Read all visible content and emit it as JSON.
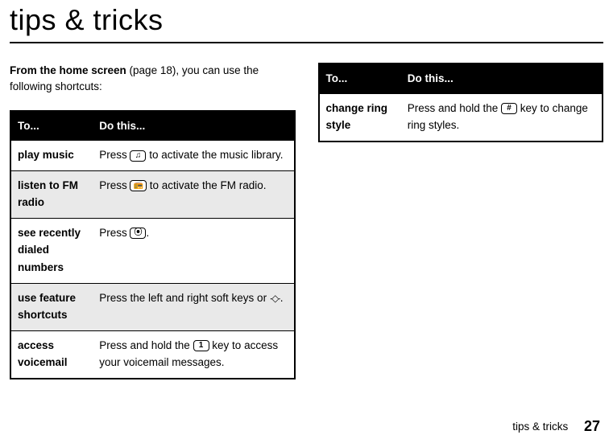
{
  "title": "tips & tricks",
  "intro": {
    "bold": "From the home screen",
    "rest": " (page 18), you can use the following shortcuts:"
  },
  "table1": {
    "headers": {
      "c1": "To...",
      "c2": "Do this..."
    },
    "rows": [
      {
        "label": "play music",
        "pre": "Press ",
        "key": "♫",
        "post": " to activate the music library."
      },
      {
        "label": "listen to FM radio",
        "pre": "Press ",
        "key": "📻",
        "post": " to activate the FM radio."
      },
      {
        "label": "see recently dialed numbers",
        "pre": "Press ",
        "key": "⦿",
        "post": "."
      },
      {
        "label": "use feature shortcuts",
        "pre": "Press the left and right soft keys or ",
        "nav": "∙◇∙",
        "post": "."
      },
      {
        "label": "access voicemail",
        "pre": "Press and hold the ",
        "key": "1",
        "post": " key to access your voicemail messages."
      }
    ]
  },
  "table2": {
    "headers": {
      "c1": "To...",
      "c2": "Do this..."
    },
    "rows": [
      {
        "label": "change ring style",
        "pre": "Press and hold the ",
        "key": "#",
        "post": " key to change ring styles."
      }
    ]
  },
  "footer": {
    "text": "tips & tricks",
    "page": "27"
  }
}
